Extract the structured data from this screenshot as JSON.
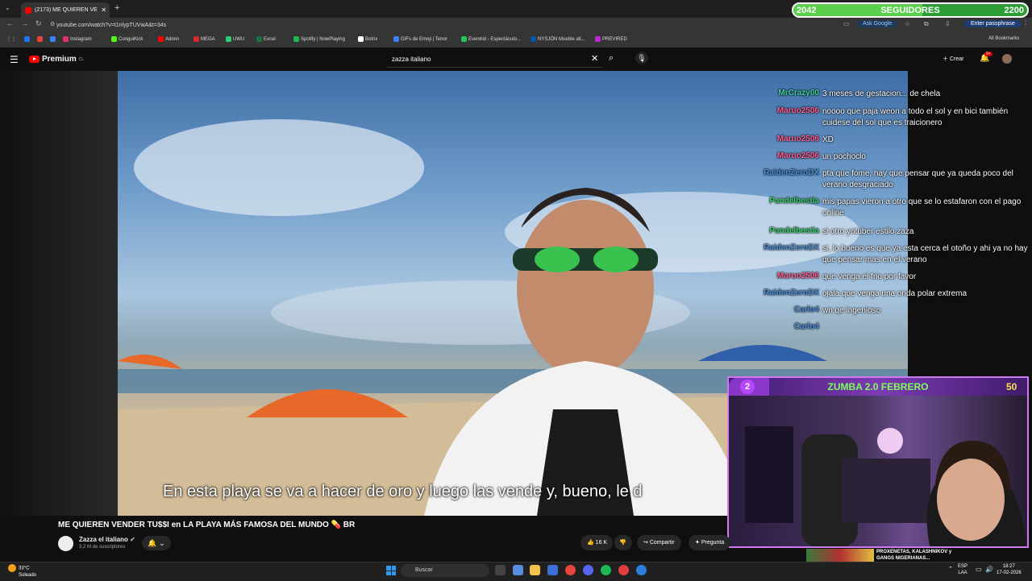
{
  "browser": {
    "tab_title": "(2173) ME QUIEREN VENDE",
    "url": "youtube.com/watch?v=t1nlypTUVwA&t=34s",
    "ask_google": "Ask Google",
    "enter_passphrase": "Enter passphrase",
    "all_bookmarks": "All Bookmarks",
    "bookmarks": [
      {
        "label": "Instagram",
        "color": "#e1306c"
      },
      {
        "label": "ConguiKick",
        "color": "#53fc18"
      },
      {
        "label": "Admin",
        "color": "#ff0000"
      },
      {
        "label": "MEGA",
        "color": "#d9272e"
      },
      {
        "label": "UWU",
        "color": "#2ecc71"
      },
      {
        "label": "Excel",
        "color": "#1d6f42"
      },
      {
        "label": "Spotify | NowPlaying",
        "color": "#1db954"
      },
      {
        "label": "Botrix",
        "color": "#ffffff"
      },
      {
        "label": "GIFs de Emoji | Tenor",
        "color": "#3b82f6"
      },
      {
        "label": "Eventrid - Espectáculo...",
        "color": "#22c55e"
      },
      {
        "label": "NYSJÖN Mueble alt...",
        "color": "#0058a3"
      },
      {
        "label": "PREVIRED",
        "color": "#c026d3"
      }
    ]
  },
  "followers": {
    "current": "2042",
    "label": "SEGUIDORES",
    "goal": "2200",
    "progress": 0.55
  },
  "youtube": {
    "logo": "Premium",
    "logo_region": "CL",
    "search_value": "zazza italiano",
    "create_label": "Crear",
    "notifications": "9+"
  },
  "video": {
    "caption": "En esta playa se va a hacer de oro y luego las vende y, bueno, le d",
    "title": "ME QUIEREN VENDER TU$$I en LA PLAYA MÁS FAMOSA DEL MUNDO 💊 BR",
    "channel": "Zazza el italiano",
    "subscribers": "3,2 M de suscriptores",
    "likes": "16 K",
    "share": "Compartir",
    "ask": "Pregunta"
  },
  "chat": [
    {
      "user": "MrCrazy00",
      "color": "#3fd0a0",
      "text": "3 meses de gestacion... de chela"
    },
    {
      "user": "Maruo2506",
      "color": "#ff5f95",
      "text": "noooo que paja weon a todo el sol y en bici también cuidese del sol que es traicionero"
    },
    {
      "user": "Maruo2506",
      "color": "#ff5f95",
      "text": "XD"
    },
    {
      "user": "Maruo2506",
      "color": "#ff5f95",
      "text": "un pochoclo"
    },
    {
      "user": "RaidenZeroDX",
      "color": "#4a8fd8",
      "text": "pta que fome, hay que pensar que ya queda poco del verano desgraciado"
    },
    {
      "user": "Pandelbestia",
      "color": "#39d16b",
      "text": "mis papas vieron a otro que se lo estafaron con el pago online"
    },
    {
      "user": "Pandelbestia",
      "color": "#39d16b",
      "text": "si otro yotuber estilo zaza"
    },
    {
      "user": "RaidenZeroDX",
      "color": "#4a8fd8",
      "text": "si, lo bueno es que ya esta cerca el otoño y ahi ya no hay que pensar mas en el verano"
    },
    {
      "user": "Maruo2506",
      "color": "#ff5f95",
      "text": "que venga el frio por favor"
    },
    {
      "user": "RaidenZeroDX",
      "color": "#4a8fd8",
      "text": "ojala que venga una onda polar extrema"
    },
    {
      "user": "Carlo4",
      "color": "#4a8fd8",
      "text": "wn qe ingenioso"
    },
    {
      "user": "Carlo4",
      "color": "#4a8fd8",
      "text": ""
    }
  ],
  "facecam": {
    "badge": "2",
    "title": "ZUMBA 2.0 FEBRERO",
    "count": "50"
  },
  "recommendation": {
    "title": "PROXENETAS, KALASHNIKOV y GANGS NIGERIANAS..."
  },
  "taskbar": {
    "temp": "33°C",
    "weather": "Soleado",
    "search": "Buscar",
    "lang1": "ESP",
    "lang2": "LAA",
    "time": "18:27",
    "date": "17-02-2026"
  }
}
